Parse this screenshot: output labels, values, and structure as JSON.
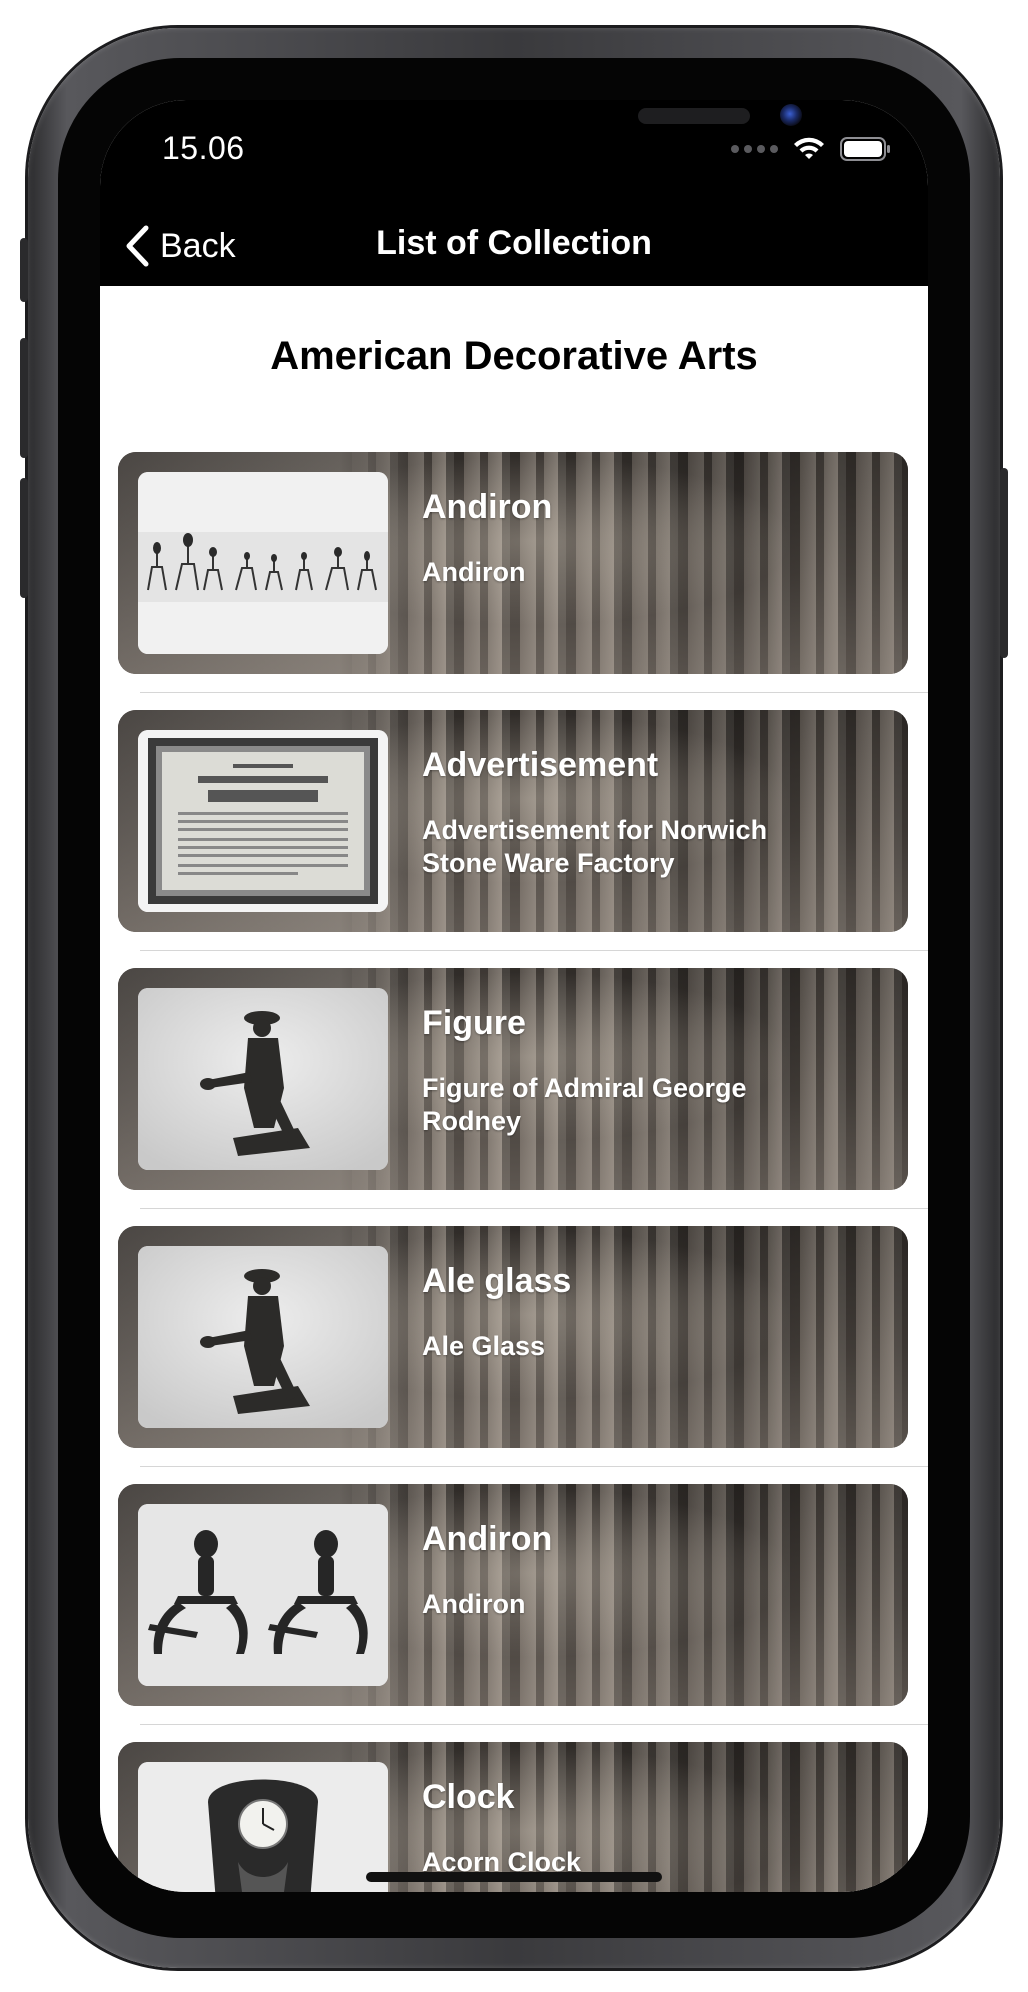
{
  "status_bar": {
    "time": "15.06",
    "icons": [
      "cellular-dots-icon",
      "wifi-icon",
      "battery-icon"
    ]
  },
  "nav": {
    "back_label": "Back",
    "title": "List of Collection"
  },
  "collection_title": "American Decorative Arts",
  "items": [
    {
      "title": "Andiron",
      "subtitle": "Andiron",
      "thumb": "andirons-row-photo"
    },
    {
      "title": "Advertisement",
      "subtitle": "Advertisement for Norwich Stone Ware Factory",
      "thumb": "framed-advertisement-photo"
    },
    {
      "title": "Figure",
      "subtitle": "Figure of Admiral George Rodney",
      "thumb": "figure-statue-photo"
    },
    {
      "title": "Ale glass",
      "subtitle": "Ale Glass",
      "thumb": "figure-statue-photo"
    },
    {
      "title": "Andiron",
      "subtitle": "Andiron",
      "thumb": "andiron-pair-photo"
    },
    {
      "title": "Clock",
      "subtitle": "Acorn Clock",
      "thumb": "clock-photo"
    }
  ],
  "colors": {
    "nav_background": "#000000",
    "content_background": "#ffffff",
    "card_text": "#ffffff"
  }
}
